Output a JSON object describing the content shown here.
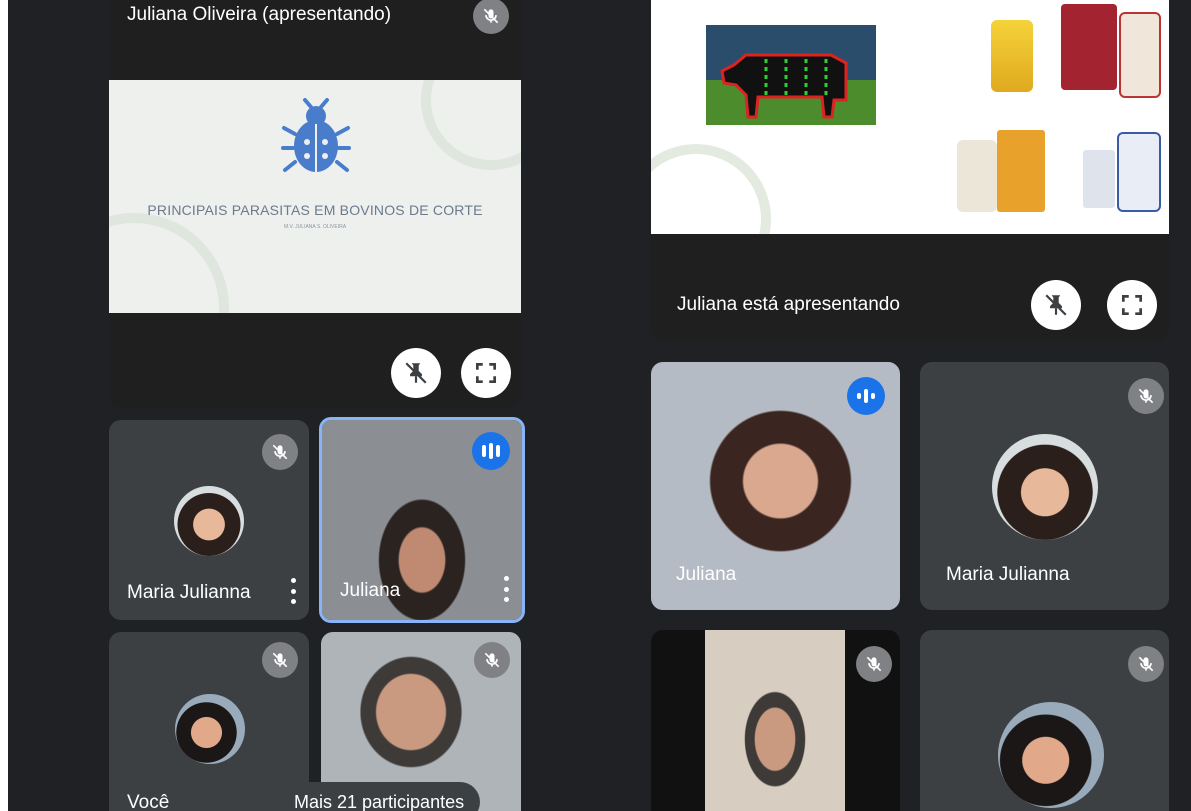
{
  "presenter_tile": {
    "title": "Juliana Oliveira (apresentando)",
    "slide_title": "PRINCIPAIS PARASITAS EM BOVINOS DE CORTE",
    "slide_subtitle": "M.V. JULIANA S. OLIVEIRA"
  },
  "shared_screen": {
    "caption": "Juliana está apresentando"
  },
  "participants": [
    {
      "name": "Maria Julianna",
      "muted": true
    },
    {
      "name": "Juliana",
      "speaking": true
    },
    {
      "name": "Você",
      "muted": true
    },
    {
      "name": "",
      "muted": true
    },
    {
      "name": "Juliana",
      "speaking": true
    },
    {
      "name": "Maria Julianna",
      "muted": true
    },
    {
      "name": "",
      "muted": true
    },
    {
      "name": "",
      "muted": true
    }
  ],
  "more_participants": "Mais 21 participantes",
  "icons": [
    "mic-off-icon",
    "unpin-icon",
    "fullscreen-icon",
    "more-options-icon",
    "speaking-indicator-icon",
    "bug-icon"
  ],
  "colors": {
    "background": "#202124",
    "tile": "#3c4043",
    "accent": "#1a73e8"
  }
}
